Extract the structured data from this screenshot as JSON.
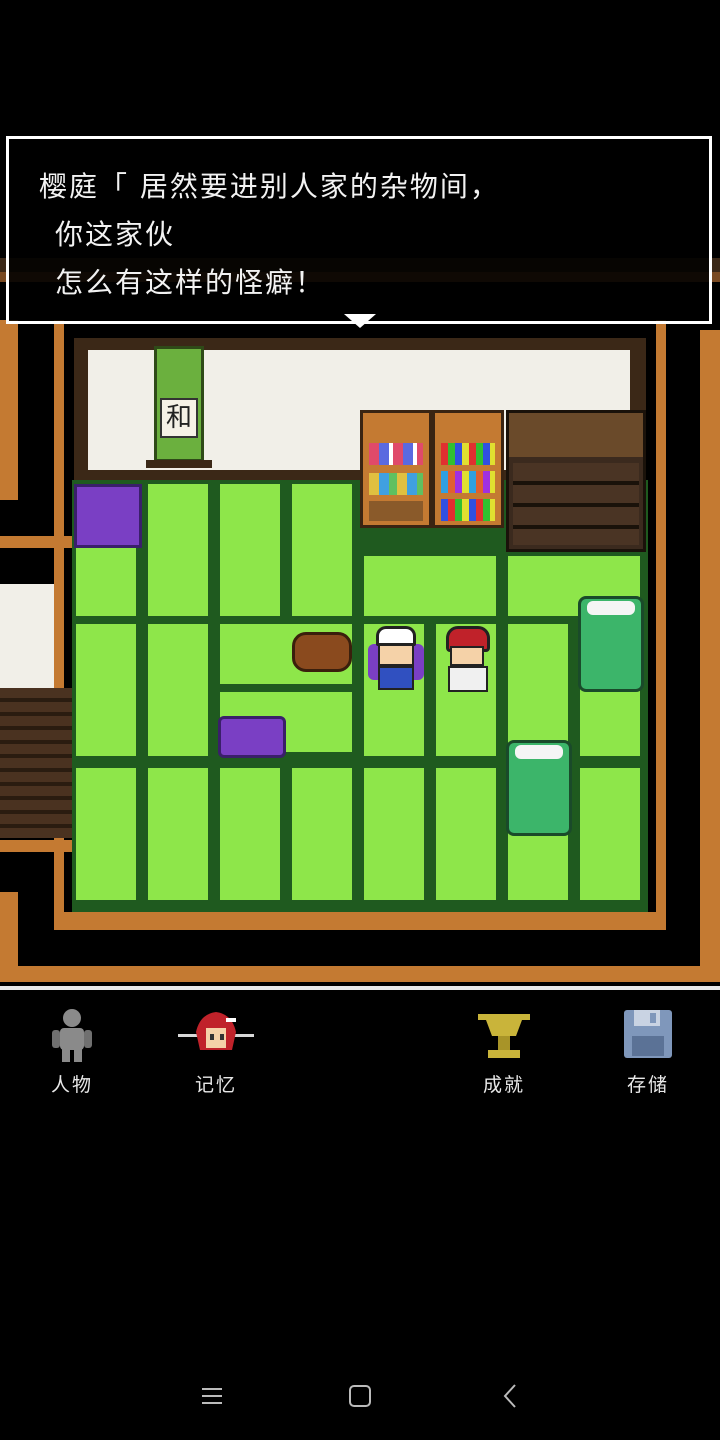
{
  "dialog": {
    "line1": "樱庭「 居然要进别人家的杂物间，",
    "line2": "你这家伙",
    "line3": "怎么有这样的怪癖！"
  },
  "scroll": {
    "text": "和"
  },
  "menu": {
    "items": [
      {
        "id": "characters",
        "label": "人物",
        "icon": "person-silhouette-icon"
      },
      {
        "id": "memories",
        "label": "记忆",
        "icon": "red-hair-portrait-icon"
      },
      {
        "id": "achievements",
        "label": "成就",
        "icon": "trophy-icon"
      },
      {
        "id": "save",
        "label": "存储",
        "icon": "floppy-disk-icon"
      }
    ]
  },
  "navbar": {
    "recent_icon": "menu-lines-icon",
    "home_icon": "square-icon",
    "back_icon": "back-chevron-icon"
  },
  "colors": {
    "tatami": "#8ee64a",
    "tatami_border": "#1f5a1f",
    "wood": "#c47a32",
    "cushion": "#7a3fc4",
    "futon": "#3cb56a",
    "trophy": "#c9b43a",
    "floppy": "#7f97bb"
  }
}
